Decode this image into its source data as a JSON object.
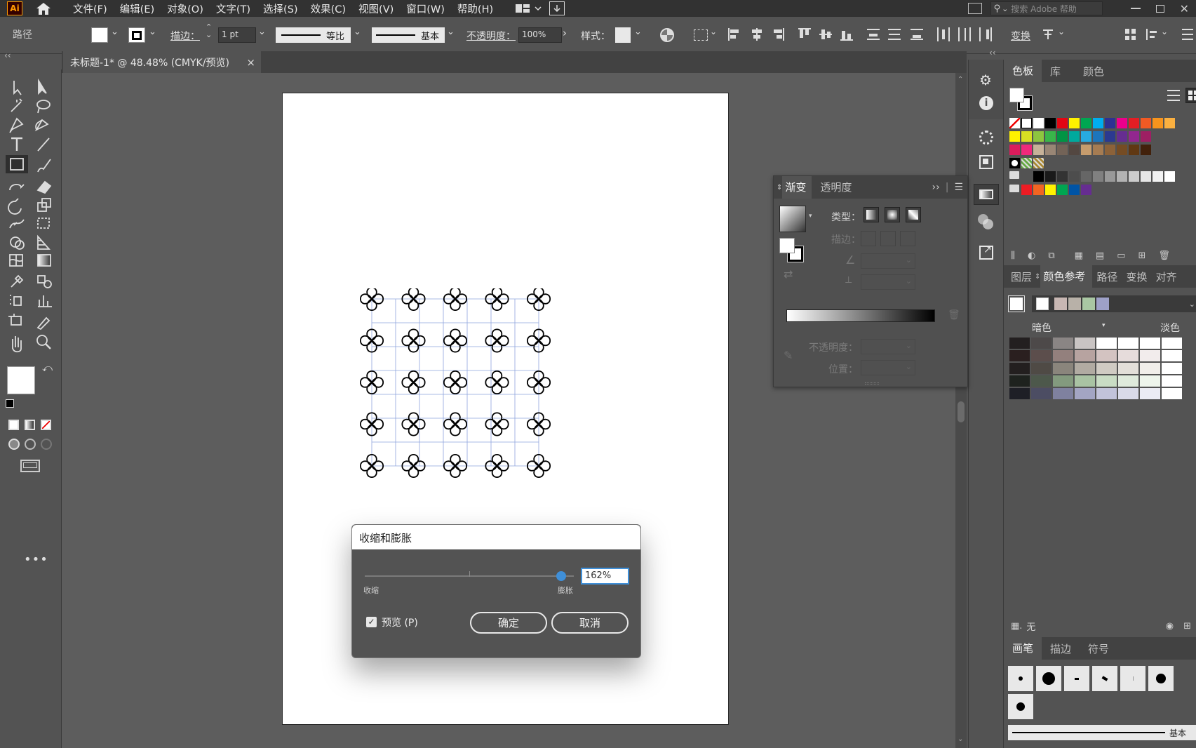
{
  "app": {
    "logo": "Ai"
  },
  "menu": [
    "文件(F)",
    "编辑(E)",
    "对象(O)",
    "文字(T)",
    "选择(S)",
    "效果(C)",
    "视图(V)",
    "窗口(W)",
    "帮助(H)"
  ],
  "search": {
    "placeholder": "搜索 Adobe 帮助"
  },
  "control": {
    "object_type": "路径",
    "stroke_label": "描边：",
    "stroke_value": "1 pt",
    "profile_label": "等比",
    "brush_label": "基本",
    "opacity_label": "不透明度：",
    "opacity_value": "100%",
    "style_label": "样式：",
    "transform_label": "变换"
  },
  "document_tab": {
    "title": "未标题-1* @ 48.48% (CMYK/预览)",
    "close": "×"
  },
  "gradient_panel": {
    "tabs": [
      "渐变",
      "透明度"
    ],
    "type_label": "类型：",
    "stroke_label": "描边：",
    "opacity_label": "不透明度：",
    "location_label": "位置："
  },
  "right_panel": {
    "top_tabs": [
      "色板",
      "库",
      "颜色"
    ],
    "mid_tabs": [
      "图层",
      "颜色参考",
      "路径",
      "变换",
      "对齐"
    ],
    "dark_label": "暗色",
    "light_label": "淡色",
    "none_label": "无",
    "bottom_tabs": [
      "画笔",
      "描边",
      "符号"
    ],
    "brush_basic": "基本"
  },
  "dialog": {
    "title": "收缩和膨胀",
    "shrink_label": "收缩",
    "expand_label": "膨胀",
    "value": "162%",
    "slider_fraction": 0.94,
    "preview_label": "预览 (P)",
    "preview_checked": true,
    "ok_label": "确定",
    "cancel_label": "取消"
  },
  "colors": {
    "ui_dark": "#323232",
    "ui_mid": "#535353",
    "accent": "#3f8fd8",
    "grid_line": "#8ea4dd"
  },
  "swatch_rows": [
    [
      "#ffffff",
      "#000000",
      "#e30613",
      "#fff200",
      "#00a651",
      "#00aeef",
      "#2e3192",
      "#ec008c",
      "#e31e24",
      "#f15a24",
      "#f7941d",
      "#fbb040"
    ],
    [
      "#fff200",
      "#d7df23",
      "#8dc63f",
      "#39b54a",
      "#009444",
      "#00a99d",
      "#27aae1",
      "#1c75bc",
      "#2b3990",
      "#662d91",
      "#92278f",
      "#9e1f63"
    ],
    [
      "#da1c5c",
      "#ee2a7b",
      "#c7b299",
      "#998675",
      "#736357",
      "#534741",
      "#c69c6d",
      "#a67c52",
      "#8c6239",
      "#754c24",
      "#603813",
      "#42210b"
    ],
    [
      "#000000",
      "#1a1a1a",
      "#333333",
      "#4d4d4d",
      "#666666",
      "#808080",
      "#999999",
      "#b3b3b3",
      "#cccccc",
      "#e6e6e6",
      "#f2f2f2",
      "#ffffff"
    ],
    [
      "#ed1c24",
      "#f26522",
      "#fff200",
      "#00a651",
      "#0054a6",
      "#662d91"
    ]
  ],
  "guide_colors": [
    "#ffffff",
    "#c8b7b3",
    "#b8b1a8",
    "#a9c7a3",
    "#9ea1c8"
  ],
  "guide_grid": [
    [
      "#231f20",
      "#4d4949",
      "#8a8584",
      "#c9c4c3",
      "#ffffff",
      "#ffffff",
      "#ffffff",
      "#ffffff"
    ],
    [
      "#2a1f1f",
      "#5c4e4c",
      "#93807d",
      "#b7a3a0",
      "#d3c3c1",
      "#e6dcdb",
      "#f2ecec",
      "#ffffff"
    ],
    [
      "#231f1f",
      "#4f4a45",
      "#8a857c",
      "#b1aba2",
      "#d0cbc3",
      "#e3dfd9",
      "#f1eeea",
      "#ffffff"
    ],
    [
      "#1e221e",
      "#4d584b",
      "#839a7e",
      "#a9c3a3",
      "#c9dcc4",
      "#dfeadc",
      "#eef5ec",
      "#ffffff"
    ],
    [
      "#1e1f26",
      "#4c4d63",
      "#7f819f",
      "#a3a5c3",
      "#c2c3da",
      "#d9dae9",
      "#ebecf4",
      "#ffffff"
    ]
  ]
}
